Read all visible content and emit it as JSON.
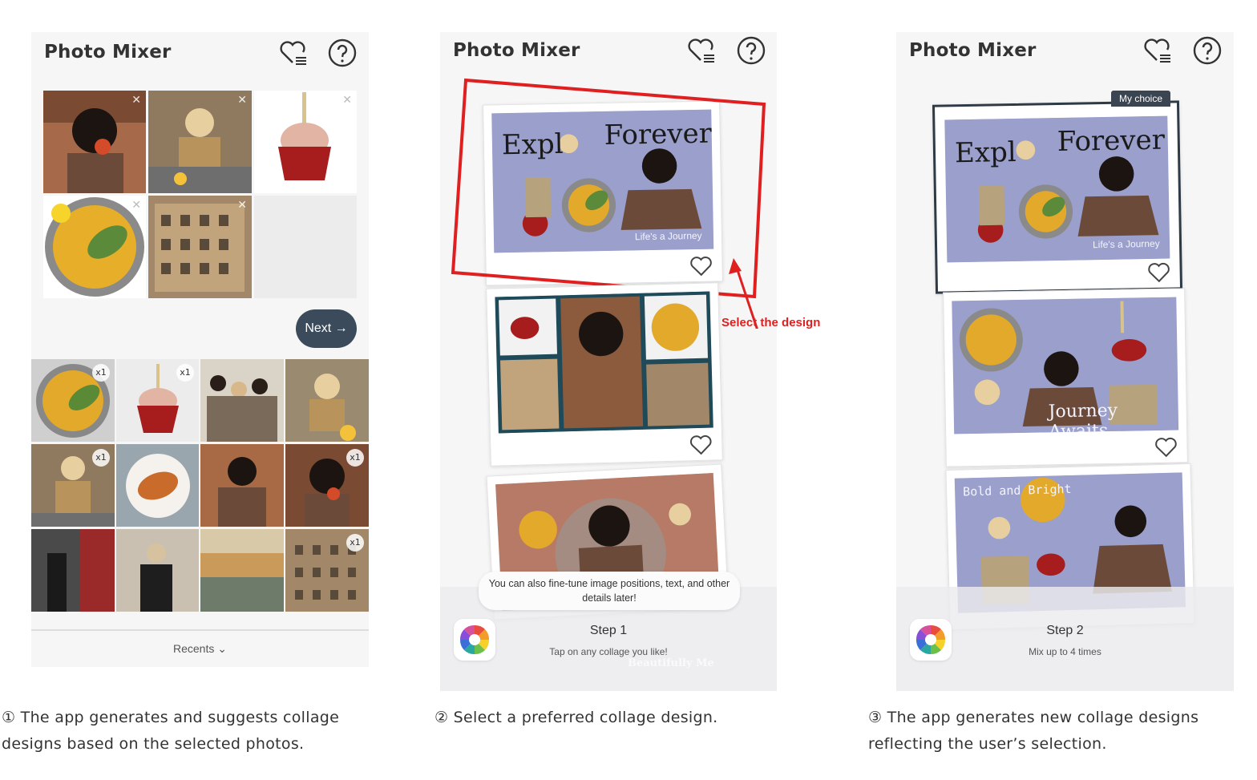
{
  "screens": [
    {
      "title": "Photo Mixer",
      "selected_photos": [
        "photo-woman-eating",
        "photo-woman-sunglasses",
        "photo-cupcake",
        "photo-salad-plate",
        "photo-building"
      ],
      "next_label": "Next →",
      "gallery_badges": [
        "x1",
        "x1",
        "x1",
        "x1",
        "x1"
      ],
      "recents_label": "Recents ⌄"
    },
    {
      "title": "Photo Mixer",
      "card1_text_left": "Expl",
      "card1_text_right": "Forever",
      "card1_sub": "Life's a Journey",
      "annotation": "Select the design",
      "tip": "You can also fine-tune image positions, text, and other details later!",
      "step_title": "Step 1",
      "step_sub": "Tap on any collage you like!",
      "behind_text": "Beautifully Me"
    },
    {
      "title": "Photo Mixer",
      "choice_badge": "My choice",
      "card1_text_left": "Expl",
      "card1_text_right": "Forever",
      "card1_sub": "Life's a Journey",
      "card2_text": "Journey Awaits",
      "card3_text": "Bold and Bright",
      "step_title": "Step 2",
      "step_sub": "Mix up to 4 times"
    }
  ],
  "captions": [
    "① The app generates and suggests collage designs based on the selected photos.",
    "② Select a preferred collage design.",
    "③ The app generates new collage designs reflecting the user’s selection."
  ],
  "colors": {
    "accent_dark": "#3b4b5c",
    "collage_purple": "#9a9fcc",
    "annotation_red": "#e02020"
  }
}
